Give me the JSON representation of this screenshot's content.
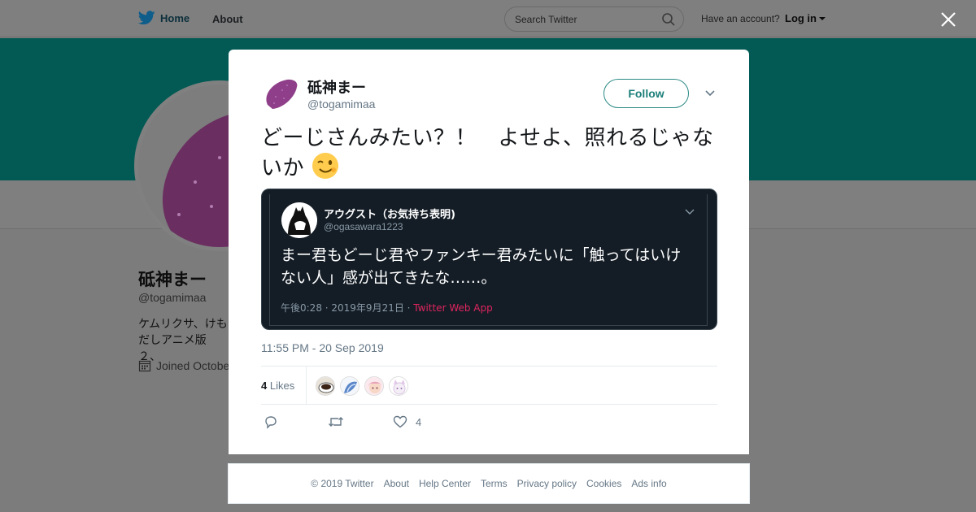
{
  "topbar": {
    "home_label": "Home",
    "about_label": "About",
    "search_placeholder": "Search Twitter",
    "account_prompt": "Have an account?",
    "login_label": "Log in",
    "brand_color": "#1da1f2"
  },
  "profile": {
    "name": "砥神まー",
    "handle": "@togamimaa",
    "bio": "ケムリクサ、けも\nだしアニメ版２、",
    "joined": "Joined Octobe",
    "banner_color": "#035a54"
  },
  "tweet": {
    "author_name": "砥神まー",
    "author_handle": "@togamimaa",
    "follow_label": "Follow",
    "text": "どーじさんみたい？！　よせよ、照れるじゃないか",
    "emoji": "wink-emoji",
    "timestamp": "11:55 PM - 20 Sep 2019",
    "likes_count": "4",
    "likes_label": "Likes",
    "like_action_count": "4"
  },
  "quoted": {
    "author_name": "アウグスト（お気持ち表明)",
    "author_handle": "@ogasawara1223",
    "text": "まー君もどーじ君やファンキー君みたいに「触ってはいけない人」感が出てきたな……。",
    "time": "午後0:28 · 2019年9月21日 · ",
    "app": "Twitter Web App",
    "bg_color": "#141d26",
    "app_color": "#e0245e"
  },
  "footer": {
    "copyright": "© 2019 Twitter",
    "about": "About",
    "help": "Help Center",
    "terms": "Terms",
    "privacy": "Privacy policy",
    "cookies": "Cookies",
    "ads": "Ads info"
  }
}
